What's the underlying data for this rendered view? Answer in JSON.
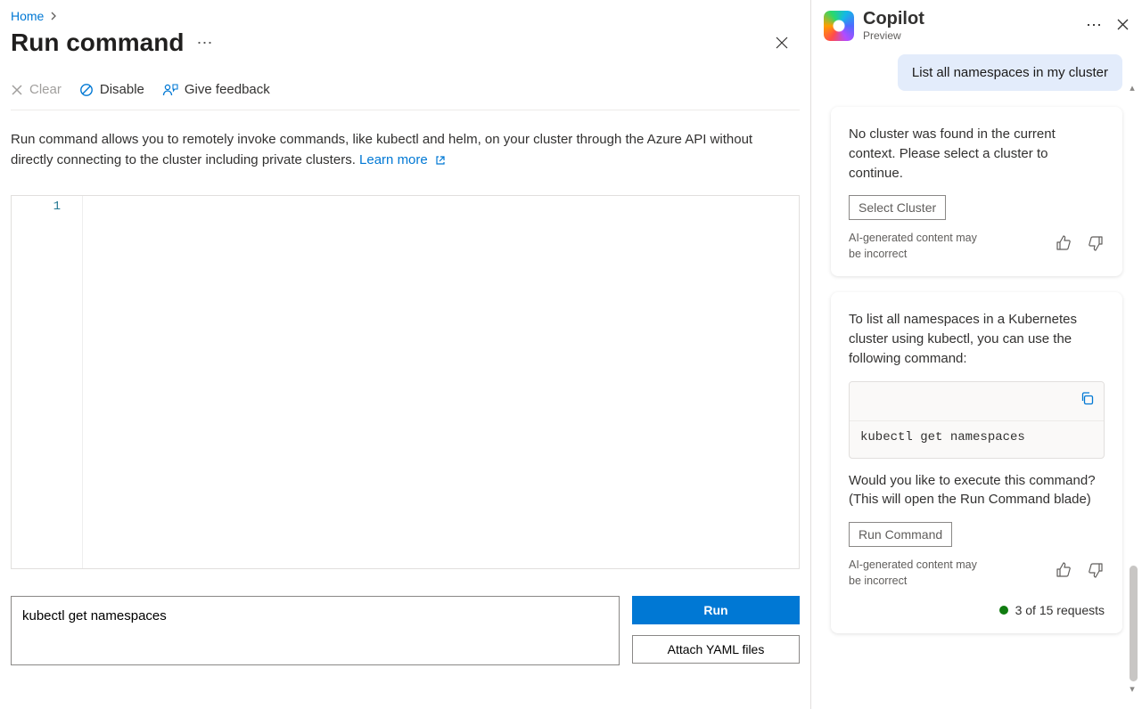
{
  "breadcrumb": {
    "home": "Home"
  },
  "page": {
    "title": "Run command"
  },
  "toolbar": {
    "clear": "Clear",
    "disable": "Disable",
    "feedback": "Give feedback"
  },
  "description": {
    "text": "Run command allows you to remotely invoke commands, like kubectl and helm, on your cluster through the Azure API without directly connecting to the cluster including private clusters. ",
    "learn_more": "Learn more"
  },
  "editor": {
    "line1": "1"
  },
  "command_input": {
    "value": "kubectl get namespaces"
  },
  "buttons": {
    "run": "Run",
    "attach": "Attach YAML files"
  },
  "copilot": {
    "title": "Copilot",
    "subtitle": "Preview",
    "user_msg": "List all namespaces in my cluster",
    "card1": {
      "text": "No cluster was found in the current context. Please select a cluster to continue.",
      "button": "Select Cluster",
      "disclaimer": "AI-generated content may be incorrect"
    },
    "card2": {
      "intro": "To list all namespaces in a Kubernetes cluster using kubectl, you can use the following command:",
      "code": "kubectl get namespaces",
      "followup": "Would you like to execute this command? (This will open the Run Command blade)",
      "button": "Run Command",
      "disclaimer": "AI-generated content may be incorrect"
    },
    "requests": "3 of 15 requests"
  }
}
